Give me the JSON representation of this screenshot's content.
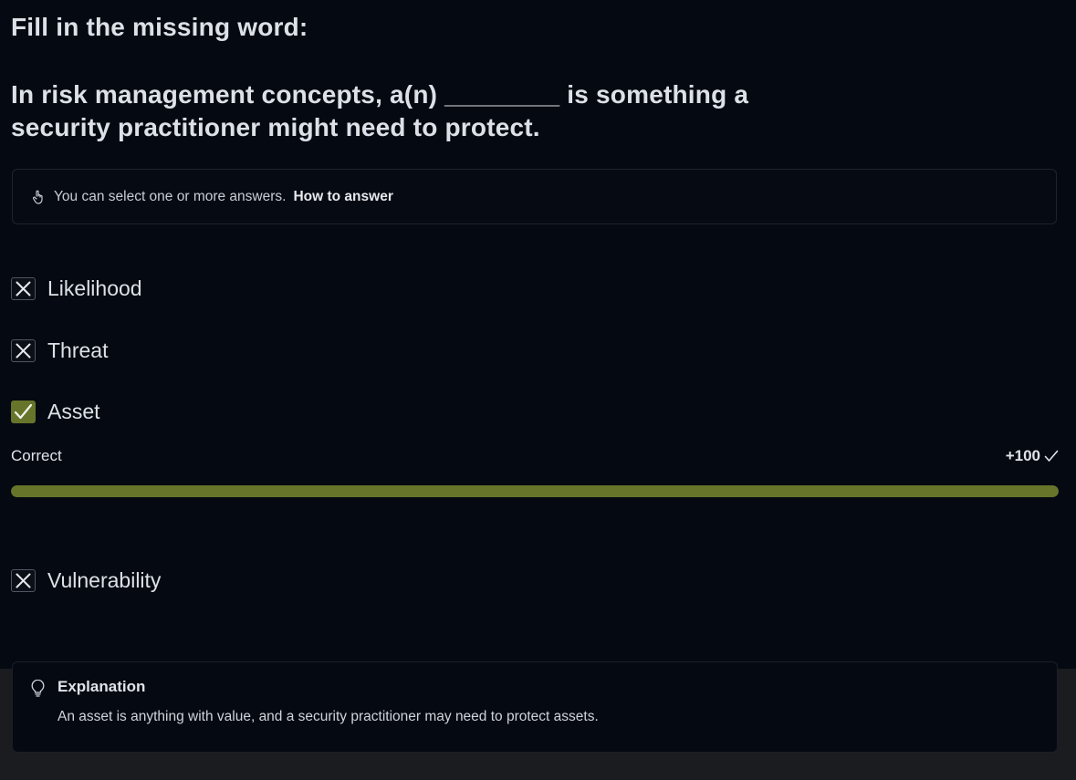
{
  "question": {
    "instruction": "Fill in the missing word:",
    "text": "In risk management concepts, a(n) ________ is something a security practitioner might need to protect."
  },
  "hint": {
    "icon": "hand-pointer-icon",
    "text": "You can select one or more answers.",
    "link_label": "How to answer"
  },
  "options": [
    {
      "label": "Likelihood",
      "state": "incorrect",
      "icon": "x-icon"
    },
    {
      "label": "Threat",
      "state": "incorrect",
      "icon": "x-icon"
    },
    {
      "label": "Asset",
      "state": "correct",
      "icon": "check-icon"
    },
    {
      "label": "Vulnerability",
      "state": "incorrect",
      "icon": "x-icon"
    }
  ],
  "result": {
    "label": "Correct",
    "points": "+100",
    "progress_percent": 100,
    "accent_color": "#66752a"
  },
  "explanation": {
    "icon": "lightbulb-icon",
    "title": "Explanation",
    "text": "An asset is anything with value, and a security practitioner may need to protect assets."
  }
}
